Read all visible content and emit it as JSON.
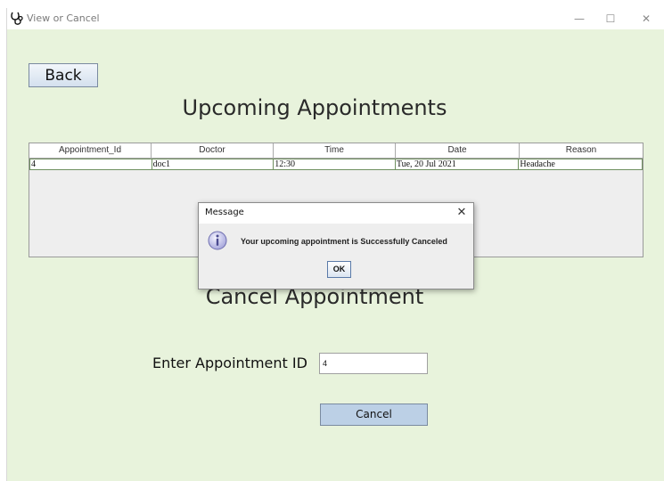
{
  "window": {
    "title": "View or Cancel",
    "icon": "stethoscope-icon",
    "minimize_glyph": "—",
    "maximize_glyph": "☐",
    "close_glyph": "✕"
  },
  "back_label": "Back",
  "upcoming_title": "Upcoming Appointments",
  "table": {
    "columns": [
      "Appointment_Id",
      "Doctor",
      "Time",
      "Date",
      "Reason"
    ],
    "rows": [
      [
        "4",
        "doc1",
        "12:30",
        "Tue, 20 Jul 2021",
        "Headache"
      ]
    ]
  },
  "cancel_title": "Cancel Appointment",
  "enter_id_label": "Enter Appointment ID",
  "appointment_id_value": "4",
  "cancel_label": "Cancel",
  "dialog": {
    "title": "Message",
    "close_glyph": "✕",
    "message": "Your upcoming appointment is Successfully Canceled",
    "ok_label": "OK",
    "icon": "info-icon"
  },
  "colors": {
    "background": "#e8f3dc",
    "button_blue": "#bcd0e6"
  }
}
